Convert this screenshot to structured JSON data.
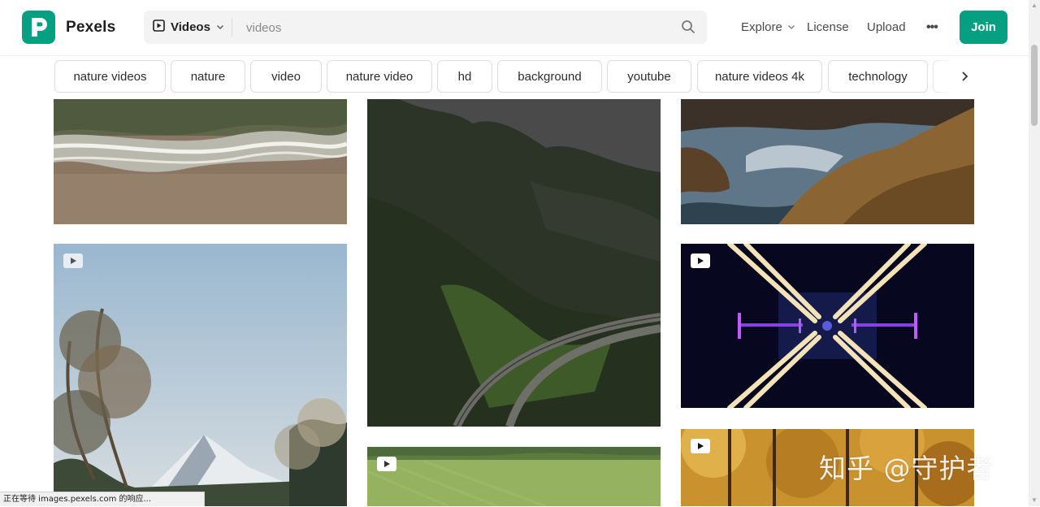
{
  "header": {
    "logo_text": "Pexels",
    "search_type_label": "Videos",
    "search_placeholder": "videos",
    "nav": {
      "explore": "Explore",
      "license": "License",
      "upload": "Upload"
    },
    "join_label": "Join"
  },
  "chips": [
    "nature videos",
    "nature",
    "video",
    "nature video",
    "hd",
    "background",
    "youtube",
    "nature videos 4k",
    "technology",
    "more"
  ],
  "colors": {
    "brand": "#05a081"
  },
  "status_text": "正在等待 images.pexels.com 的响应...",
  "watermark": "知乎 @守护者"
}
